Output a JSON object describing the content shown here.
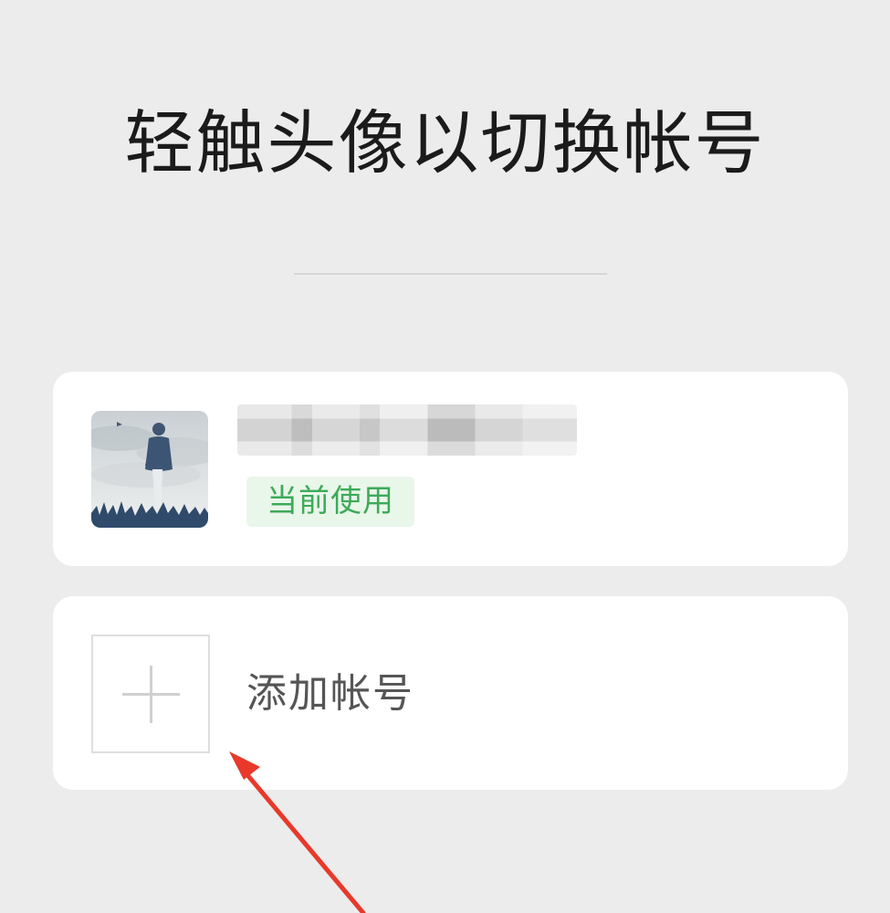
{
  "header": {
    "title": "轻触头像以切换帐号"
  },
  "accounts": {
    "current": {
      "avatar_icon": "user-avatar-photo",
      "name": "",
      "status_badge": "当前使用",
      "badge_color": "#3daa58"
    },
    "add": {
      "icon": "plus-icon",
      "label": "添加帐号"
    }
  },
  "annotation": {
    "arrow_color": "#e8392b"
  }
}
